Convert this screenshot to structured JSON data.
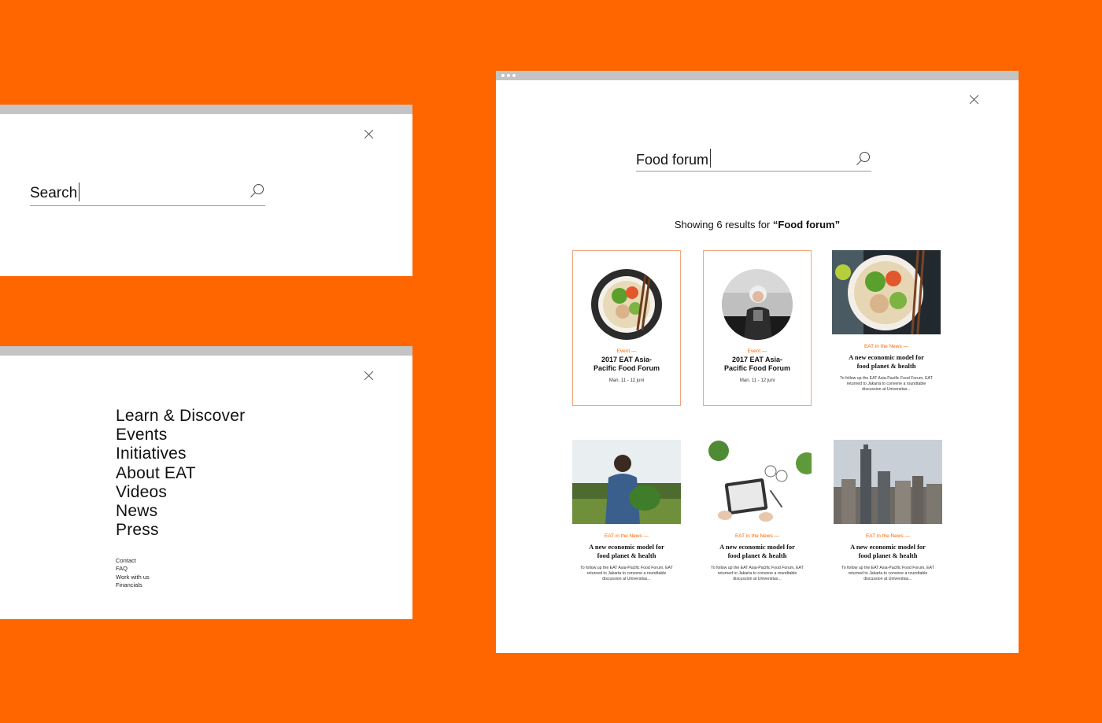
{
  "search_window": {
    "query": "Search"
  },
  "menu_window": {
    "main_items": [
      "Learn & Discover",
      "Events",
      "Initiatives",
      "About EAT",
      "Videos",
      "News",
      "Press"
    ],
    "secondary_items": [
      "Contact",
      "FAQ",
      "Work with us",
      "Financials"
    ]
  },
  "results_window": {
    "query": "Food forum",
    "summary_prefix": "Showing 6 results for ",
    "summary_query": "“Food forum”",
    "cards": [
      {
        "category": "Event —",
        "title_line1": "2017 EAT Asia-",
        "title_line2": "Pacific Food Forum",
        "date": "Man. 11 - 12 juni"
      },
      {
        "category": "Event —",
        "title_line1": "2017 EAT Asia-",
        "title_line2": "Pacific Food Forum",
        "date": "Man. 11 - 12 juni"
      },
      {
        "category": "EAT in the News —",
        "title_line1": "A new economic model for",
        "title_line2": "food planet & health",
        "excerpt": "To follow up the EAT Asia-Pacific Food Forum, EAT returned to Jakarta to convene a roundtable discussion at Universitas..."
      },
      {
        "category": "EAT in the News —",
        "title_line1": "A new economic model for",
        "title_line2": "food planet & health",
        "excerpt": "To follow up the EAT Asia-Pacific Food Forum, EAT returned to Jakarta to convene a roundtable discussion at Universitas..."
      },
      {
        "category": "EAT in the News —",
        "title_line1": "A new economic model for",
        "title_line2": "food planet & health",
        "excerpt": "To follow up the EAT Asia-Pacific Food Forum, EAT returned to Jakarta to convene a roundtable discussion at Universitas..."
      },
      {
        "category": "EAT in the News —",
        "title_line1": "A new economic model for",
        "title_line2": "food planet & health",
        "excerpt": "To follow up the EAT Asia-Pacific Food Forum, EAT returned to Jakarta to convene a roundtable discussion at Universitas..."
      }
    ]
  },
  "colors": {
    "background": "#ff6600",
    "accent": "#ff6600",
    "window_bar": "#c4c4c4",
    "card_border": "#f4a47a"
  },
  "icons": [
    "close-icon",
    "search-icon"
  ]
}
